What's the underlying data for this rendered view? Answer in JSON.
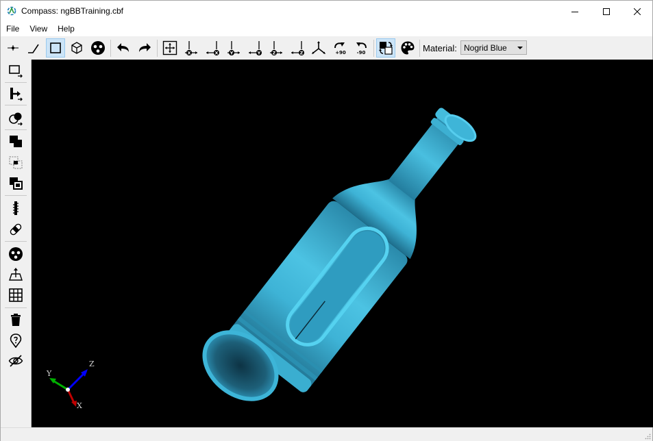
{
  "window": {
    "title": "Compass: ngBBTraining.cbf"
  },
  "menu": {
    "items": [
      "File",
      "View",
      "Help"
    ]
  },
  "toolbar": {
    "buttons": [
      {
        "name": "point-select-tool",
        "icon": "point-icon"
      },
      {
        "name": "edge-select-tool",
        "icon": "edge-icon"
      },
      {
        "name": "face-select-tool",
        "icon": "face-icon",
        "active": true
      },
      {
        "name": "body-select-tool",
        "icon": "cube-icon"
      },
      {
        "name": "feature-select-tool",
        "icon": "dots-circle-icon"
      },
      {
        "name": "undo",
        "icon": "undo-icon"
      },
      {
        "name": "redo",
        "icon": "redo-icon"
      },
      {
        "name": "zoom-fit",
        "icon": "fit-all-icon"
      },
      {
        "name": "view-plus-x",
        "icon": "axis-x-icon"
      },
      {
        "name": "view-minus-x",
        "icon": "axis-x-neg-icon"
      },
      {
        "name": "view-plus-y",
        "icon": "axis-y-icon"
      },
      {
        "name": "view-minus-y",
        "icon": "axis-y-neg-icon"
      },
      {
        "name": "view-plus-z",
        "icon": "axis-z-icon"
      },
      {
        "name": "view-minus-z",
        "icon": "axis-z-neg-icon"
      },
      {
        "name": "view-isometric",
        "icon": "isometric-icon"
      },
      {
        "name": "rotate-plus-90",
        "icon": "rotate-plus-90-icon",
        "label": "+90"
      },
      {
        "name": "rotate-minus-90",
        "icon": "rotate-minus-90-icon",
        "label": "-90"
      },
      {
        "name": "toggle-background",
        "icon": "background-swap-icon",
        "active": true
      },
      {
        "name": "material-palette",
        "icon": "palette-icon"
      }
    ],
    "axis_letters": {
      "x": "X",
      "y": "Y",
      "z": "Z"
    },
    "material_label": "Material:",
    "material_value": "Nogrid Blue"
  },
  "sidebar": {
    "tools": [
      "select-box-icon",
      "move-icon",
      "shapes-icon",
      "union-icon",
      "intersect-icon",
      "subtract-icon",
      "measure-icon",
      "heal-icon",
      "dots-circle-icon",
      "extrude-icon",
      "grid-icon",
      "trash-icon",
      "info-marker-icon",
      "hide-icon"
    ]
  },
  "viewport": {
    "background": "#000000",
    "model_color": "#35a7c9",
    "triad": {
      "x_label": "X",
      "y_label": "Y",
      "z_label": "Z"
    }
  }
}
